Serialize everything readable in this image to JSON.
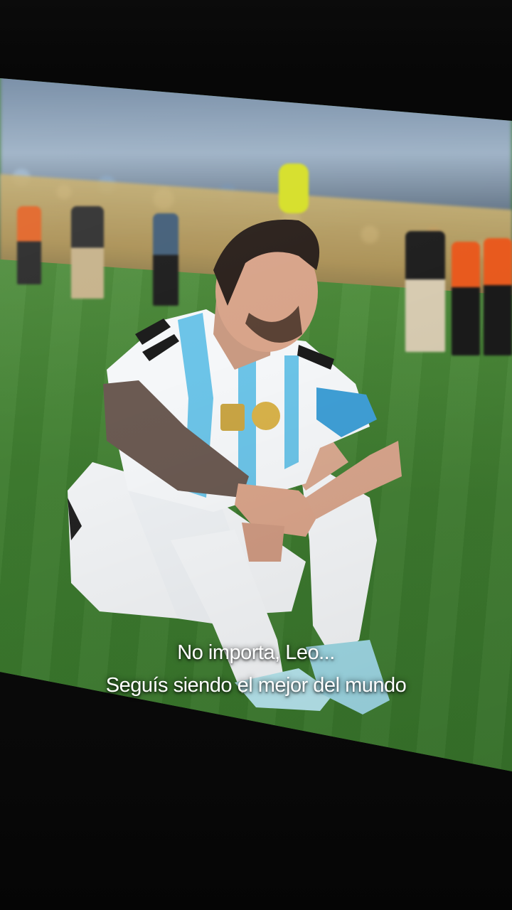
{
  "caption": {
    "line1": "No importa, Leo...",
    "line2": "Seguís siendo el mejor del mundo"
  },
  "colors": {
    "pitch": "#3f7d30",
    "jersey_blue": "#6cc4e8",
    "caption_text": "#ffffff"
  }
}
